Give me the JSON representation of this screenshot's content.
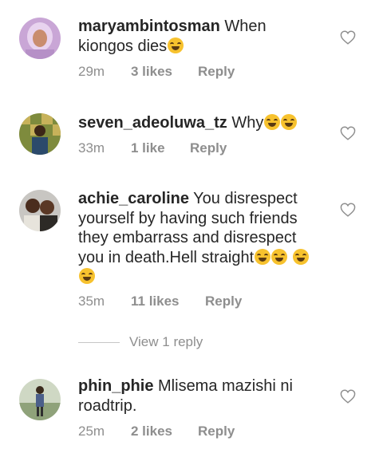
{
  "comments": [
    {
      "username": "maryambintosman",
      "text": "When kiongos dies",
      "emojis": [
        "grinning-sweat-emoji"
      ],
      "time": "29m",
      "likes": "3 likes",
      "reply": "Reply"
    },
    {
      "username": "seven_adeoluwa_tz",
      "text": "Why",
      "emojis": [
        "crying-emoji",
        "crying-emoji"
      ],
      "time": "33m",
      "likes": "1 like",
      "reply": "Reply"
    },
    {
      "username": "achie_caroline",
      "text": "You disrespect yourself by having such friends they embarrass and disrespect you in death.Hell straight",
      "emojis": [
        "tears-of-joy-emoji",
        "tears-of-joy-emoji",
        "tears-of-joy-emoji",
        "tears-of-joy-emoji"
      ],
      "time": "35m",
      "likes": "11 likes",
      "reply": "Reply",
      "view_replies": "View 1 reply"
    },
    {
      "username": "phin_phie",
      "text": "Mlisema mazishi ni roadtrip.",
      "emojis": [],
      "time": "25m",
      "likes": "2 likes",
      "reply": "Reply"
    }
  ],
  "colors": {
    "text": "#262626",
    "meta": "#8e8e8e",
    "emoji": "#f7c22e",
    "background": "#ffffff"
  },
  "icons": [
    "heart-outline-icon"
  ]
}
